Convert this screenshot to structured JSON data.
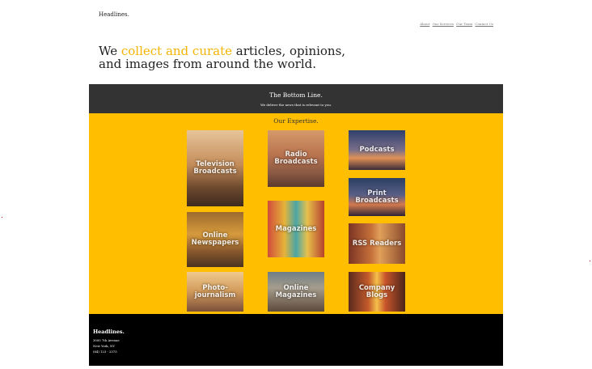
{
  "site": {
    "brand": "Headlines."
  },
  "nav": {
    "items": [
      "About",
      "Our Services",
      "Our Team",
      "Contact Us"
    ]
  },
  "hero": {
    "prefix": "We ",
    "highlight": "collect and curate",
    "suffix": " articles, opinions, and images from around the world."
  },
  "band": {
    "title": "The Bottom Line.",
    "subtitle": "We deliver the news that is relevant to you."
  },
  "expertise": {
    "heading": "Our Expertise.",
    "tiles": {
      "television": "Television Broadcasts",
      "online_newspapers": "Online Newspapers",
      "photojournalism": "Photo-journalism",
      "radio": "Radio Broadcasts",
      "magazines": "Magazines",
      "online_magazines": "Online Magazines",
      "podcasts": "Podcasts",
      "print": "Print Broadcasts",
      "rss": "RSS Readers",
      "blogs": "Company Blogs"
    }
  },
  "footer": {
    "name": "Headlines.",
    "address1": "3000 7th Avenue",
    "address2": "New York, NY",
    "phone": "(64) 123 - 2375"
  },
  "colors": {
    "accent": "#ffbe00",
    "band": "#333333",
    "footer": "#000000",
    "highlight": "#f5b400"
  }
}
